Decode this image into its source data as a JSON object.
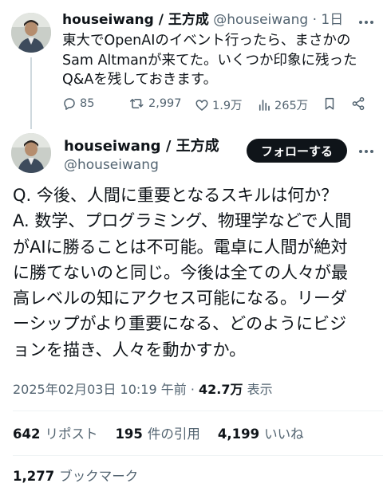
{
  "reply_tweet": {
    "display_name": "houseiwang / 王方成",
    "handle": "@houseiwang",
    "separator": "·",
    "time": "1日",
    "text": "東大でOpenAIのイベント行ったら、まさかのSam Altmanが来てた。いくつか印象に残ったQ&Aを残しておきます。",
    "actions": {
      "replies": "85",
      "reposts": "2,997",
      "likes": "1.9万",
      "views": "265万"
    },
    "icons": [
      "reply-icon",
      "repost-icon",
      "like-icon",
      "views-icon",
      "bookmark-icon",
      "share-icon",
      "more-icon"
    ]
  },
  "main_tweet": {
    "display_name": "houseiwang / 王方成",
    "handle": "@houseiwang",
    "follow_label": "フォローする",
    "lines": [
      "Q. 今後、人間に重要となるスキルは何か？",
      "A. 数学、プログラミング、物理学などで人間",
      "がAIに勝ることは不可能。電卓に人間が絶対",
      "に勝てないのと同じ。今後は全ての人々が最",
      "高レベルの知にアクセス可能になる。リーダ",
      "ーシップがより重要になる、どのようにビジ",
      "ョンを描き、人々を動かすか。"
    ],
    "timestamp": "2025年02月03日 10:19 午前",
    "separator": "·",
    "views_count": "42.7万",
    "views_label": "表示",
    "stats": {
      "reposts_count": "642",
      "reposts_label": "リポスト",
      "quotes_count": "195",
      "quotes_label": "件の引用",
      "likes_count": "4,199",
      "likes_label": "いいね",
      "bookmarks_count": "1,277",
      "bookmarks_label": "ブックマーク"
    }
  },
  "colors": {
    "text_primary": "#0f1419",
    "text_secondary": "#536471",
    "divider": "#eff3f4",
    "thread_line": "#cfd9de",
    "follow_button": "#0f1419"
  }
}
